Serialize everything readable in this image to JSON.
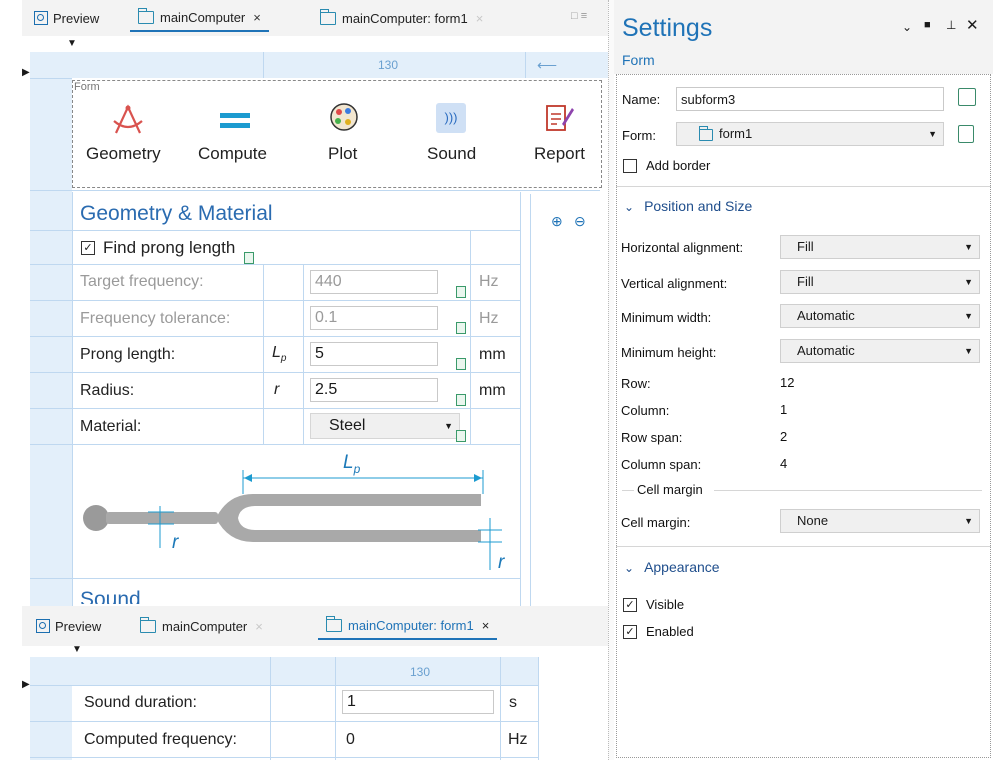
{
  "top_tabs": {
    "preview": "Preview",
    "main": "mainComputer",
    "form1": "mainComputer: form1",
    "close": "×"
  },
  "ruler": {
    "col_width": "130"
  },
  "form": {
    "caption": "Form",
    "buttons": [
      "Geometry",
      "Compute",
      "Plot",
      "Sound",
      "Report"
    ]
  },
  "geometry": {
    "heading": "Geometry & Material",
    "find_prong": "Find prong length",
    "rows": [
      {
        "label": "Target frequency:",
        "symbol": "",
        "value": "440",
        "unit": "Hz",
        "dim": true
      },
      {
        "label": "Frequency tolerance:",
        "symbol": "",
        "value": "0.1",
        "unit": "Hz",
        "dim": true
      },
      {
        "label": "Prong length:",
        "symbol": "Lp",
        "value": "5",
        "unit": "mm",
        "dim": false
      },
      {
        "label": "Radius:",
        "symbol": "r",
        "value": "2.5",
        "unit": "mm",
        "dim": false
      }
    ],
    "material_label": "Material:",
    "material_value": "Steel",
    "diagram_lp": "Lp",
    "diagram_r": "r",
    "sound_heading": "Sound"
  },
  "bottom_tabs": {
    "preview": "Preview",
    "main": "mainComputer",
    "form1": "mainComputer: form1",
    "close": "×"
  },
  "bottom_form": {
    "ruler": "130",
    "rows": [
      {
        "label": "Sound duration:",
        "value": "1",
        "unit": "s"
      },
      {
        "label": "Computed frequency:",
        "value": "0",
        "unit": "Hz"
      }
    ]
  },
  "settings": {
    "title": "Settings",
    "subtitle": "Form",
    "name_label": "Name:",
    "name_value": "subform3",
    "form_label": "Form:",
    "form_value": "form1",
    "add_border": "Add border",
    "pos_section": "Position and Size",
    "fields": [
      {
        "label": "Horizontal alignment:",
        "value": "Fill"
      },
      {
        "label": "Vertical alignment:",
        "value": "Fill"
      },
      {
        "label": "Minimum width:",
        "value": "Automatic"
      },
      {
        "label": "Minimum height:",
        "value": "Automatic"
      }
    ],
    "static_fields": [
      {
        "label": "Row:",
        "value": "12"
      },
      {
        "label": "Column:",
        "value": "1"
      },
      {
        "label": "Row span:",
        "value": "2"
      },
      {
        "label": "Column span:",
        "value": "4"
      }
    ],
    "cell_margin_group": "Cell margin",
    "cell_margin_label": "Cell margin:",
    "cell_margin_value": "None",
    "appearance_section": "Appearance",
    "visible": "Visible",
    "enabled": "Enabled"
  },
  "colors": {
    "accent": "#1f73b7",
    "grid_line": "#bfd8f0",
    "section_blue": "#2a6bb0"
  }
}
